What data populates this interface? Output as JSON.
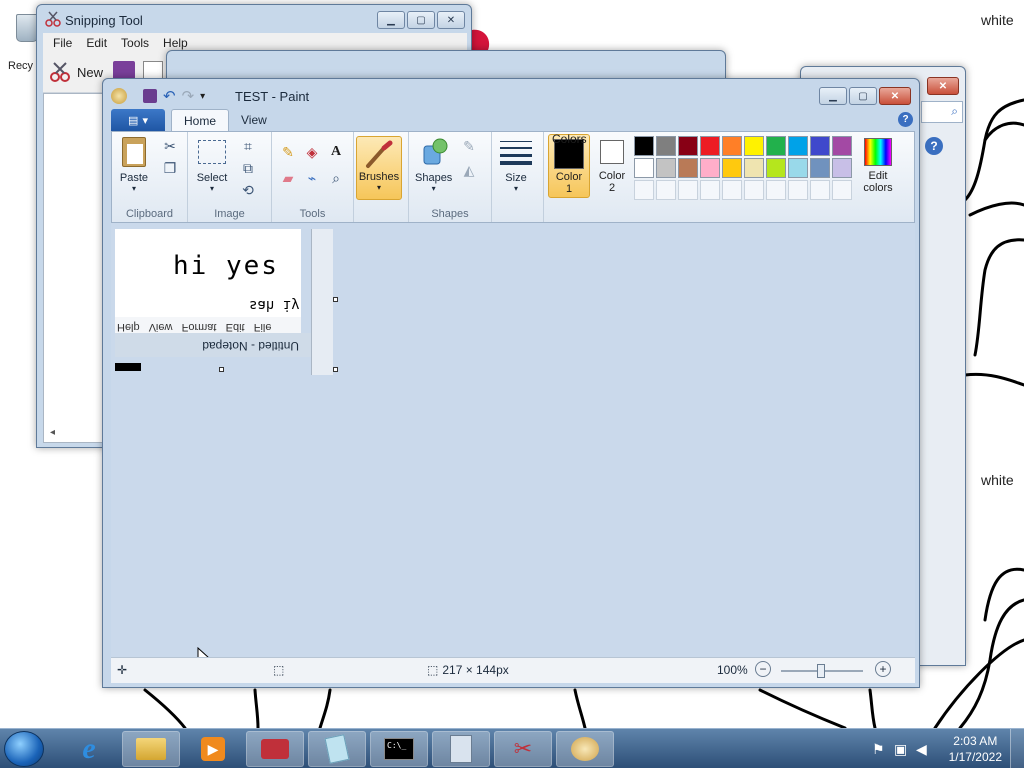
{
  "desktop": {
    "recycle_bin_label": "Recy",
    "doodle_text_1": "white",
    "doodle_text_2": "white"
  },
  "snipping_tool": {
    "title": "Snipping Tool",
    "menu": [
      "File",
      "Edit",
      "Tools",
      "Help"
    ],
    "new_label": "New"
  },
  "paint": {
    "title": "TEST - Paint",
    "tabs": {
      "home": "Home",
      "view": "View"
    },
    "groups": {
      "clipboard": "Clipboard",
      "image": "Image",
      "tools": "Tools",
      "shapes": "Shapes",
      "colors": "Colors"
    },
    "buttons": {
      "paste": "Paste",
      "select": "Select",
      "brushes": "Brushes",
      "shapes": "Shapes",
      "size": "Size",
      "color1": "Color 1",
      "color2": "Color 2",
      "edit_colors": "Edit colors"
    },
    "palette": [
      "#000000",
      "#7f7f7f",
      "#880015",
      "#ed1c24",
      "#ff7f27",
      "#fff200",
      "#22b14c",
      "#00a2e8",
      "#3f48cc",
      "#a349a4",
      "#ffffff",
      "#c3c3c3",
      "#b97a57",
      "#ffaec9",
      "#ffc90e",
      "#efe4b0",
      "#b5e61d",
      "#99d9ea",
      "#7092be",
      "#c8bfe7",
      "",
      "",
      "",
      "",
      "",
      "",
      "",
      "",
      "",
      ""
    ],
    "color1": "#000000",
    "color2": "#ffffff",
    "canvas": {
      "image_text": "hi yes",
      "flipped_text": "sah iy",
      "flipped_menu": "Help   View   Format   Edit   File",
      "flipped_title": "Untitled - Notepad"
    },
    "status": {
      "dimensions": "217 × 144px",
      "zoom": "100%"
    }
  },
  "taskbar": {
    "time": "2:03 AM",
    "date": "1/17/2022"
  }
}
